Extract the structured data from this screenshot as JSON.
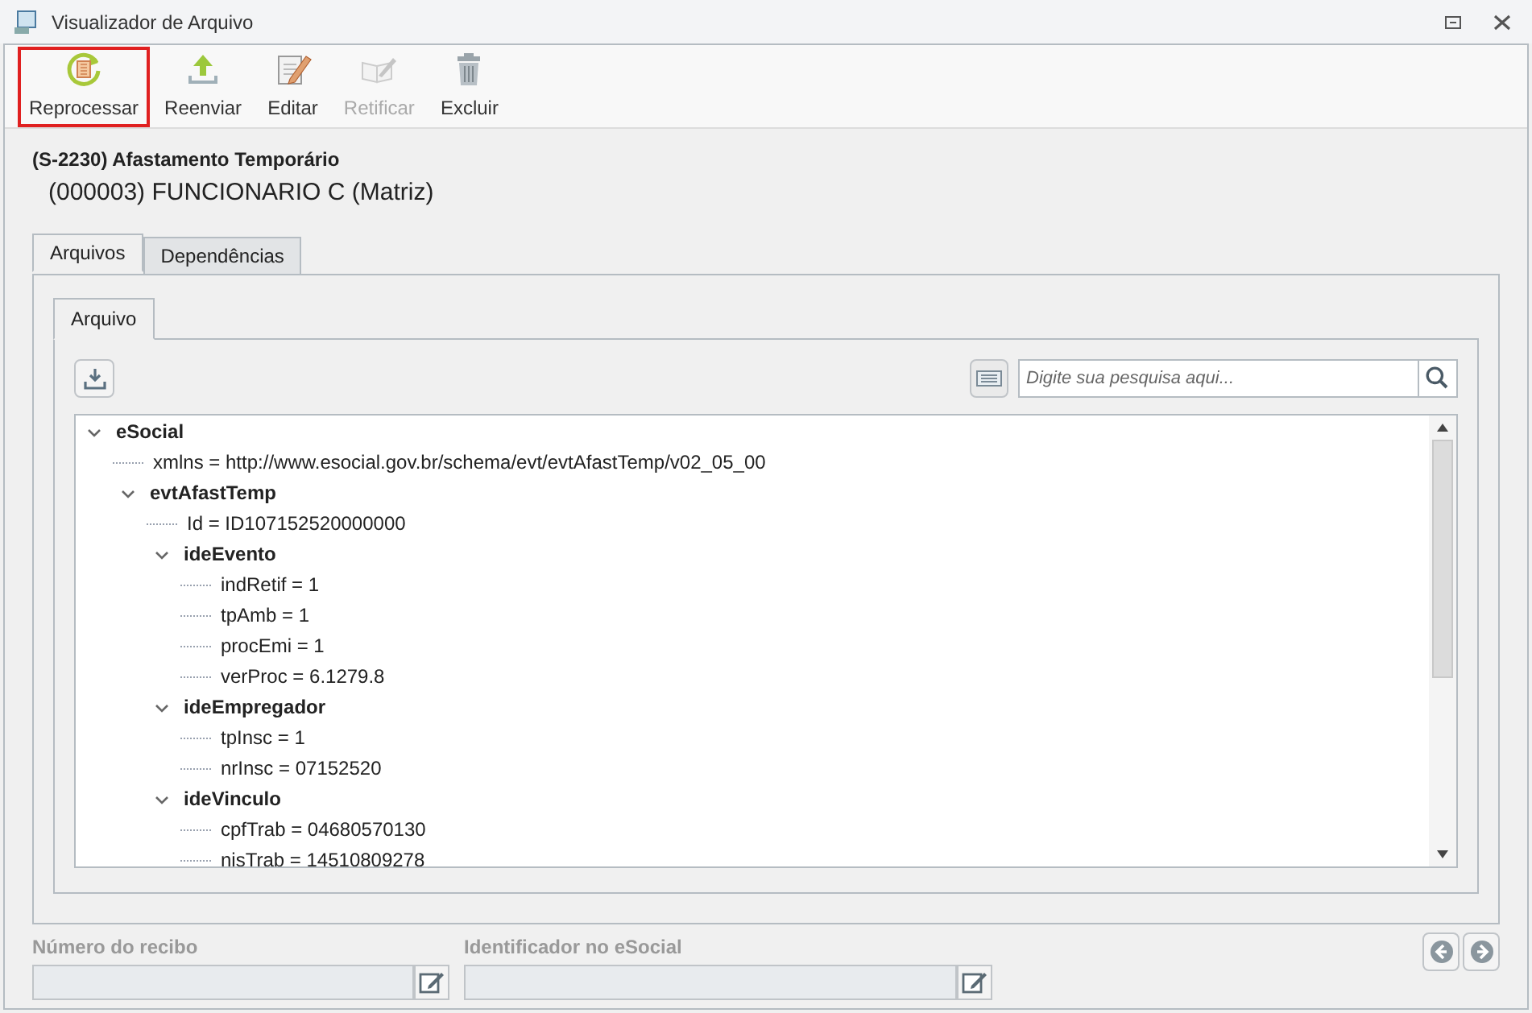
{
  "window": {
    "title": "Visualizador de Arquivo"
  },
  "toolbar": [
    {
      "label": "Reprocessar",
      "kind": "reprocess",
      "selected": true,
      "disabled": false
    },
    {
      "label": "Reenviar",
      "kind": "upload",
      "selected": false,
      "disabled": false
    },
    {
      "label": "Editar",
      "kind": "edit",
      "selected": false,
      "disabled": false
    },
    {
      "label": "Retificar",
      "kind": "rectify",
      "selected": false,
      "disabled": true
    },
    {
      "label": "Excluir",
      "kind": "trash",
      "selected": false,
      "disabled": false
    }
  ],
  "header": {
    "event": "(S-2230) Afastamento Temporário",
    "employee": "(000003) FUNCIONARIO C (Matriz)"
  },
  "tabs": [
    {
      "label": "Arquivos",
      "selected": true
    },
    {
      "label": "Dependências",
      "selected": false
    }
  ],
  "inner_tabs": [
    {
      "label": "Arquivo",
      "selected": true
    }
  ],
  "search": {
    "placeholder": "Digite sua pesquisa aqui..."
  },
  "tree": [
    {
      "label": "eSocial",
      "expanded": true,
      "children": [
        {
          "label": "xmlns = http://www.esocial.gov.br/schema/evt/evtAfastTemp/v02_05_00"
        },
        {
          "label": "evtAfastTemp",
          "expanded": true,
          "children": [
            {
              "label": "Id = ID107152520000000"
            },
            {
              "label": "ideEvento",
              "expanded": true,
              "children": [
                {
                  "label": "indRetif = 1"
                },
                {
                  "label": "tpAmb = 1"
                },
                {
                  "label": "procEmi = 1"
                },
                {
                  "label": "verProc = 6.1279.8"
                }
              ]
            },
            {
              "label": "ideEmpregador",
              "expanded": true,
              "children": [
                {
                  "label": "tpInsc = 1"
                },
                {
                  "label": "nrInsc = 07152520"
                }
              ]
            },
            {
              "label": "ideVinculo",
              "expanded": true,
              "children": [
                {
                  "label": "cpfTrab = 04680570130"
                },
                {
                  "label": "nisTrab = 14510809278"
                }
              ]
            }
          ]
        }
      ]
    }
  ],
  "fields": [
    {
      "label": "Número do recibo",
      "disabled": true
    },
    {
      "label": "Identificador no eSocial",
      "disabled": true
    }
  ]
}
